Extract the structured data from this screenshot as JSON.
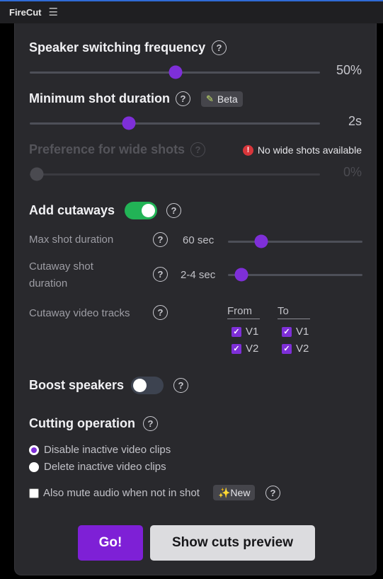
{
  "titlebar": {
    "app_name": "FireCut",
    "menu_icon": "hamburger-icon"
  },
  "help_glyph": "?",
  "speaker_switching": {
    "label": "Speaker switching frequency",
    "value_text": "50%",
    "fraction": 0.5
  },
  "min_shot": {
    "label": "Minimum shot duration",
    "badge_icon": "pencil-icon",
    "badge": "Beta",
    "value_text": "2s",
    "fraction": 0.34
  },
  "wide_shots": {
    "label": "Preference for wide shots",
    "warning": "No wide shots available",
    "warning_icon": "exclamation-icon",
    "value_text": "0%",
    "fraction": 0.0
  },
  "cutaways": {
    "label": "Add cutaways",
    "enabled": true,
    "max_shot": {
      "label": "Max shot duration",
      "value_text": "60 sec",
      "fraction": 0.25
    },
    "cutaway_shot": {
      "label": "Cutaway shot duration",
      "value_text": "2-4 sec",
      "fraction": 0.1
    },
    "tracks": {
      "label": "Cutaway video tracks",
      "from_label": "From",
      "to_label": "To",
      "from": [
        "V1",
        "V2"
      ],
      "to": [
        "V1",
        "V2"
      ]
    }
  },
  "boost_speakers": {
    "label": "Boost speakers",
    "enabled": false
  },
  "cutting": {
    "label": "Cutting operation",
    "options": [
      "Disable inactive video clips",
      "Delete inactive video clips"
    ],
    "selected": 0,
    "mute_label": "Also mute audio when not in shot",
    "mute_checked": false,
    "new_badge": "✨New"
  },
  "buttons": {
    "go": "Go!",
    "preview": "Show cuts preview"
  },
  "colors": {
    "accent": "#7e2fd8",
    "toggle_on": "#22b356",
    "warning": "#d8363b",
    "panel": "#29292d"
  }
}
